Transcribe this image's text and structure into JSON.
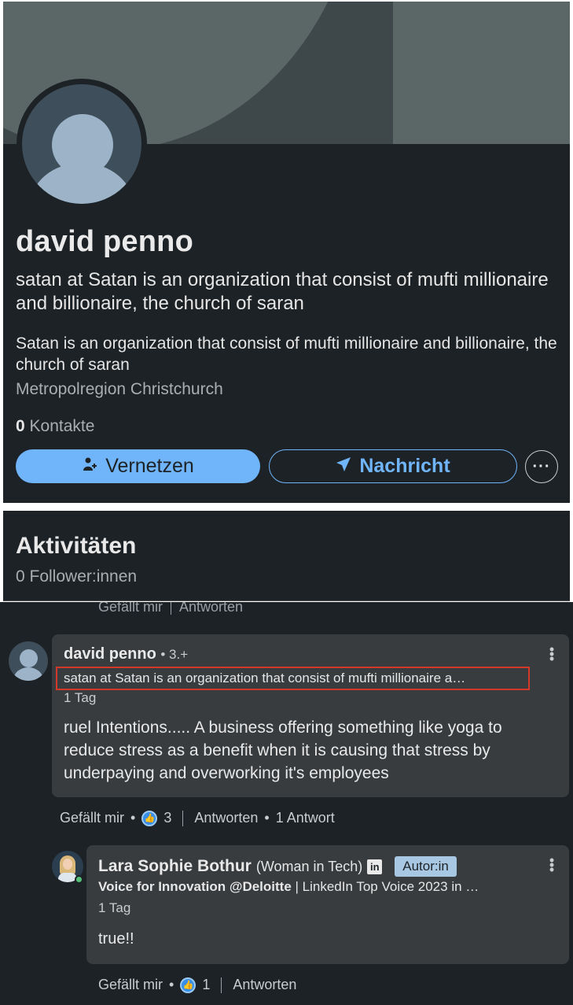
{
  "profile": {
    "name": "david penno",
    "headline": "satan at  Satan is an organization that consist of mufti millionaire and billionaire, the church of saran",
    "about": " Satan is an organization that consist of mufti millionaire and billionaire, the church of saran",
    "location": "Metropolregion Christchurch",
    "contacts_count": "0",
    "contacts_label": "Kontakte",
    "connect_label": "Vernetzen",
    "message_label": "Nachricht",
    "more_label": "···"
  },
  "activity": {
    "title": "Aktivitäten",
    "followers": "0 Follower:innen"
  },
  "previous_actions": {
    "like": "Gefällt mir",
    "reply": "Antworten"
  },
  "comment": {
    "author": "david penno",
    "degree": "• 3.+",
    "headline": "satan at Satan is an organization that consist of mufti millionaire a…",
    "time": "1 Tag",
    "text": "ruel Intentions..... A business offering something like yoga to reduce stress as a benefit when it is causing that stress by underpaying and overworking it's employees",
    "like_label": "Gefällt mir",
    "like_count": "3",
    "reply_label": "Antworten",
    "replies": "1 Antwort"
  },
  "reply": {
    "author": "Lara Sophie Bothur",
    "aside": "(Woman in Tech)",
    "linkedin_icon": "in",
    "badge": "Autor:in",
    "headline_bold": "Voice for Innovation @Deloitte",
    "headline_rest": " | LinkedIn Top Voice 2023 in …",
    "time": "1 Tag",
    "text": "true!!",
    "like_label": "Gefällt mir",
    "like_count": "1",
    "reply_label": "Antworten"
  },
  "colors": {
    "background": "#1d2226",
    "accent": "#70b5f9",
    "bubble": "#383c3f",
    "highlight_border": "#d2392b"
  },
  "icons": {
    "connect": "add-person-icon",
    "message": "send-icon",
    "more": "more-horizontal-icon",
    "like": "like-reaction-icon",
    "kebab": "more-vertical-icon"
  }
}
